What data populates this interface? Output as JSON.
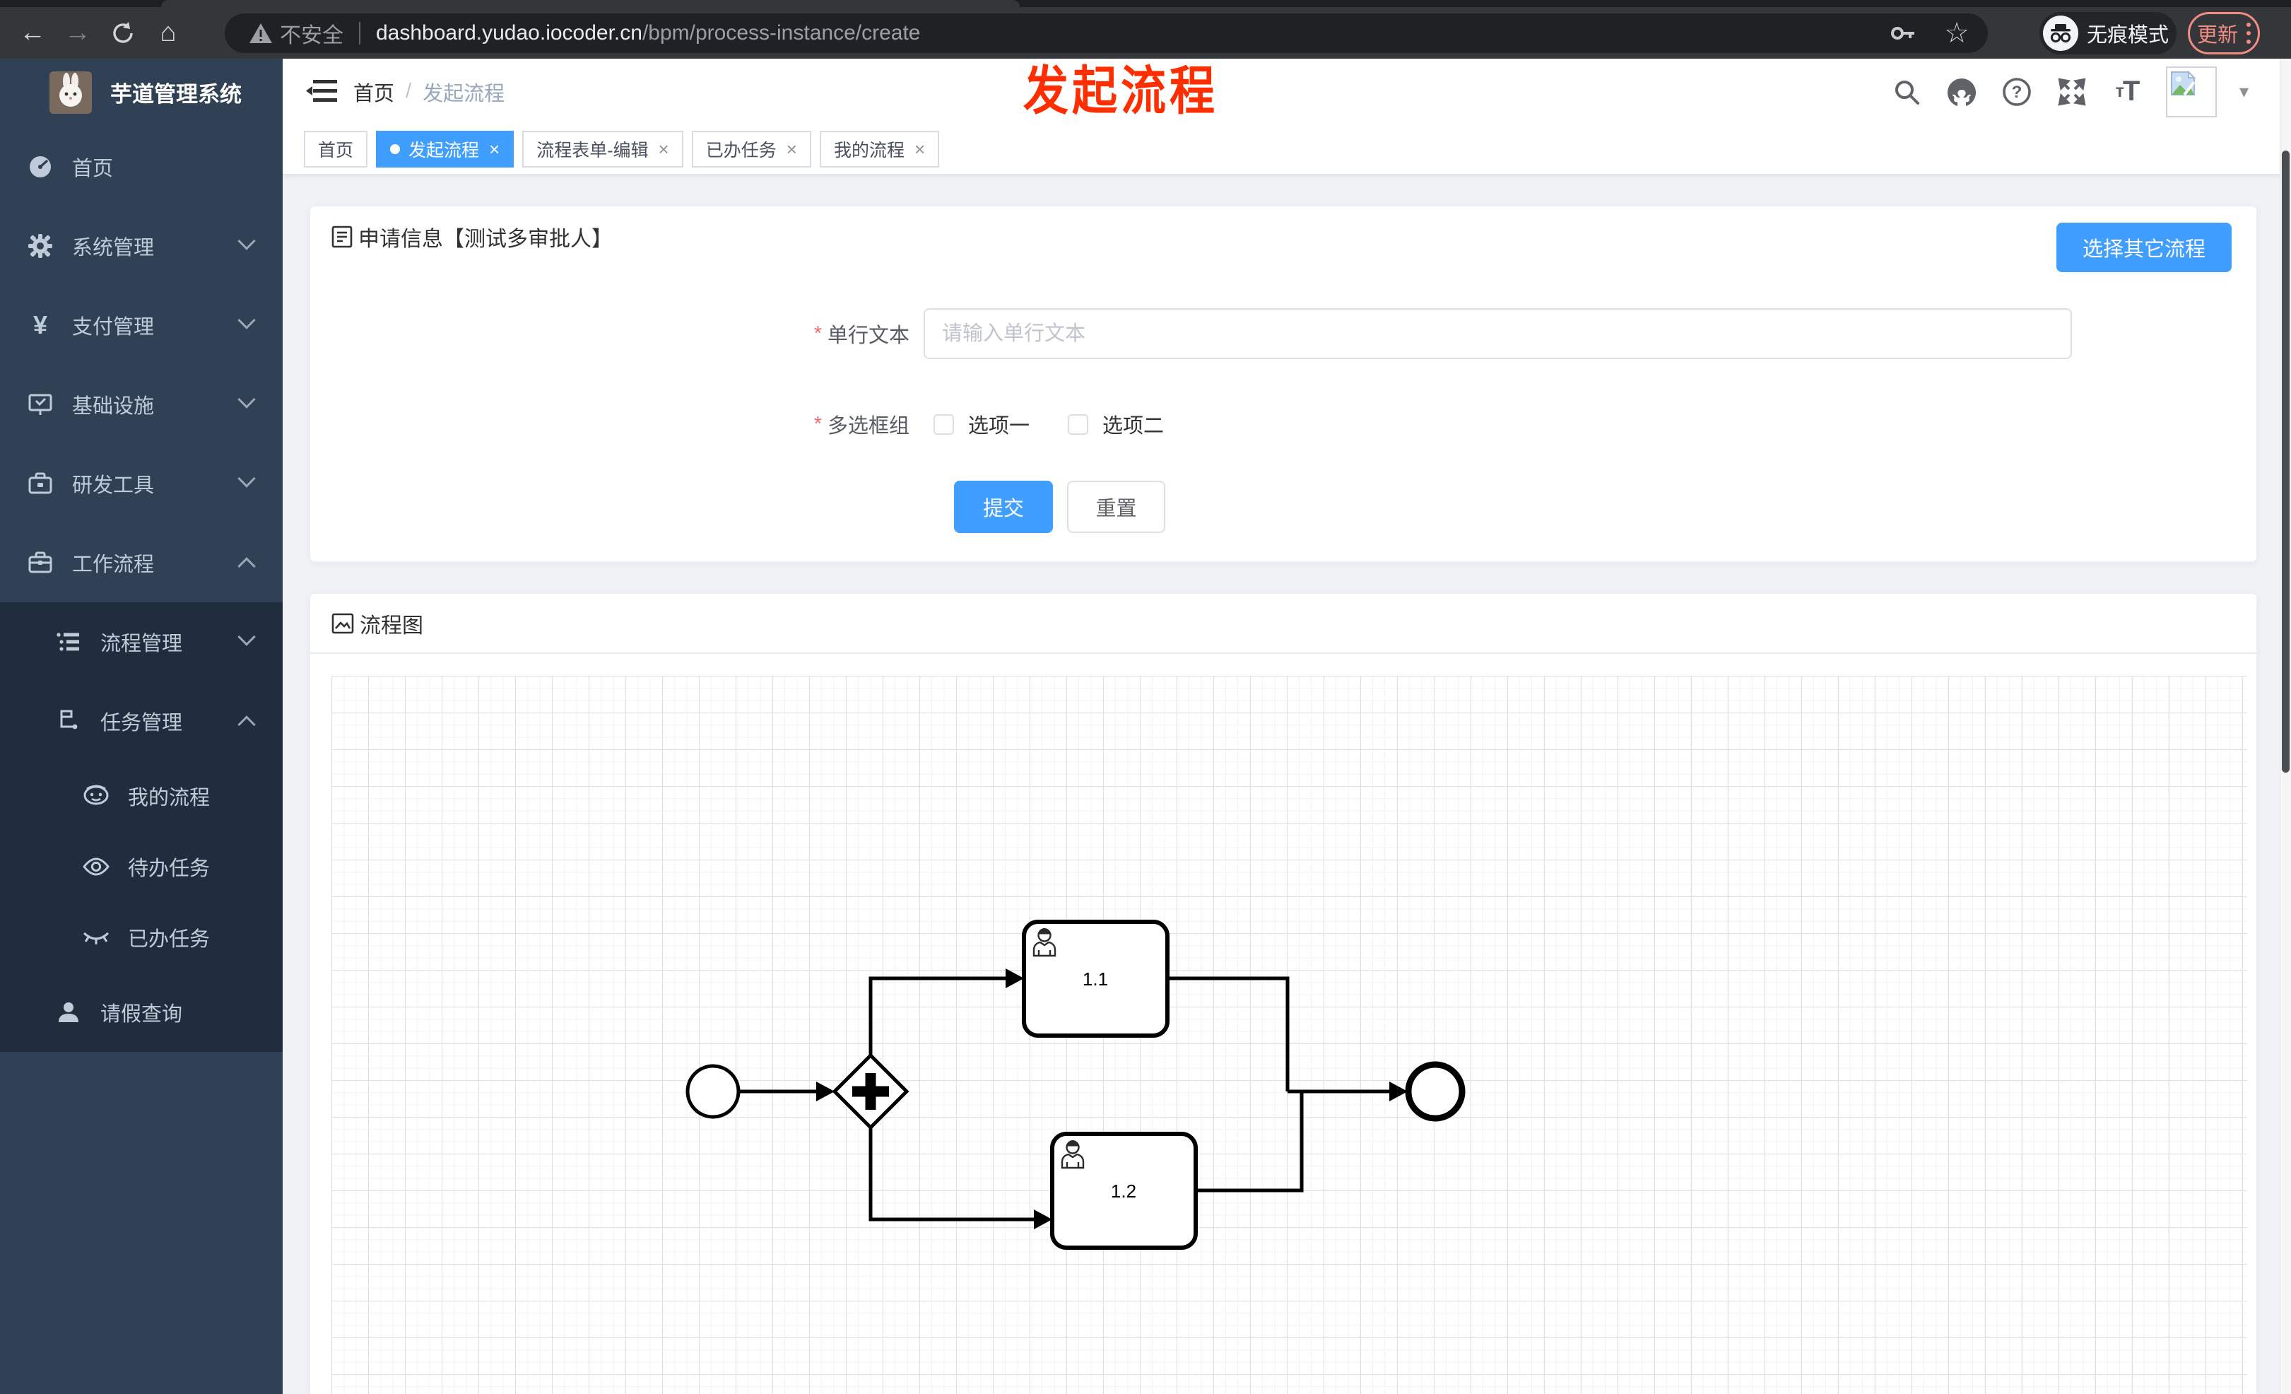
{
  "browser": {
    "security_label": "不安全",
    "url_host": "dashboard.yudao.iocoder.cn",
    "url_path": "/bpm/process-instance/create",
    "incognito_label": "无痕模式",
    "update_label": "更新"
  },
  "annotation": {
    "title": "发起流程",
    "color": "#ff2e00"
  },
  "sidebar": {
    "app_title": "芋道管理系统",
    "items": [
      {
        "label": "首页"
      },
      {
        "label": "系统管理"
      },
      {
        "label": "支付管理"
      },
      {
        "label": "基础设施"
      },
      {
        "label": "研发工具"
      },
      {
        "label": "工作流程"
      },
      {
        "label": "流程管理"
      },
      {
        "label": "任务管理"
      },
      {
        "label": "我的流程"
      },
      {
        "label": "待办任务"
      },
      {
        "label": "已办任务"
      },
      {
        "label": "请假查询"
      }
    ]
  },
  "header": {
    "breadcrumb_home": "首页",
    "breadcrumb_sep": "/",
    "breadcrumb_current": "发起流程"
  },
  "tags": [
    {
      "label": "首页"
    },
    {
      "label": "发起流程"
    },
    {
      "label": "流程表单-编辑"
    },
    {
      "label": "已办任务"
    },
    {
      "label": "我的流程"
    }
  ],
  "form_card": {
    "title": "申请信息【测试多审批人】",
    "other_process_button": "选择其它流程",
    "field_text": {
      "required": "*",
      "label": "单行文本",
      "placeholder": "请输入单行文本"
    },
    "field_checkbox": {
      "required": "*",
      "label": "多选框组",
      "option1": "选项一",
      "option2": "选项二"
    },
    "submit_label": "提交",
    "reset_label": "重置"
  },
  "diagram_card": {
    "title": "流程图",
    "task1": "1.1",
    "task2": "1.2"
  },
  "glyphs": {
    "back": "←",
    "forward": "→",
    "home": "⌂",
    "star": "☆",
    "close": "×",
    "caret": "▾",
    "yen": "¥",
    "t_small": "т",
    "t_big": "T",
    "question": "?"
  },
  "colors": {
    "accent": "#409eff",
    "sidebar_bg": "#304156",
    "submenu_bg": "#1f2d3d",
    "chrome_bg": "#35363a",
    "update_red": "#f28b82"
  }
}
